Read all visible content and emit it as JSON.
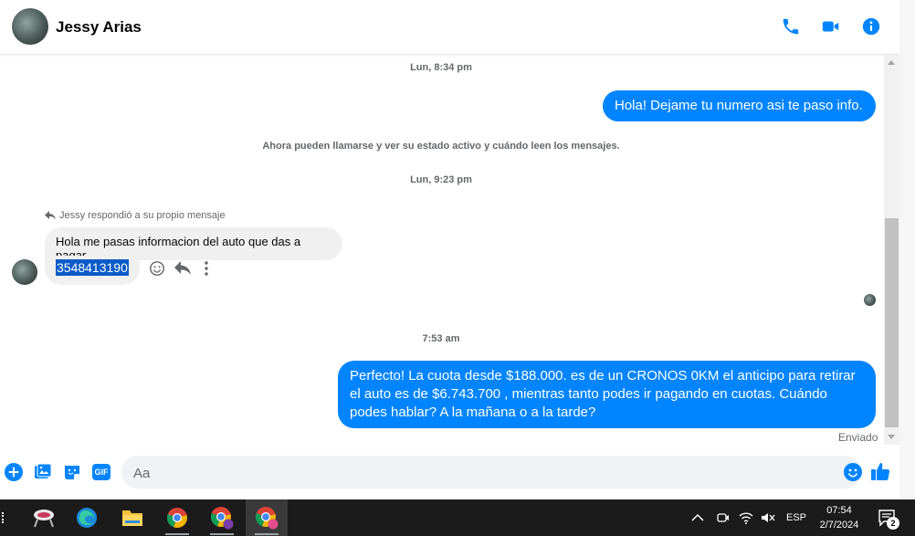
{
  "header": {
    "contact_name": "Jessy Arias",
    "icons": [
      "phone-icon",
      "video-icon",
      "info-icon"
    ],
    "accent": "#0084ff"
  },
  "conversation": {
    "timestamp_1": "Lun, 8:34 pm",
    "outgoing_1": "Hola! Dejame tu numero  asi te paso info.",
    "system_notice": "Ahora pueden llamarse y ver su estado activo y cuándo leen los mensajes.",
    "timestamp_2": "Lun, 9:23 pm",
    "reply_note": "Jessy respondió a su propio mensaje",
    "incoming_1": "Hola me pasas informacion del auto que das a pagar",
    "incoming_2_phone": "3548413190",
    "timestamp_3": "7:53 am",
    "outgoing_2": "Perfecto! La cuota desde $188.000. es de un CRONOS 0KM el anticipo para retirar el auto es de $6.743.700 , mientras tanto podes ir pagando en cuotas. Cuándo podes hablar? A la mañana o a la tarde?",
    "status": "Enviado"
  },
  "composer": {
    "placeholder": "Aa",
    "icons": [
      "plus-icon",
      "image-icon",
      "sticker-icon",
      "gif-icon",
      "emoji-icon",
      "like-icon"
    ],
    "gif_label": "GIF"
  },
  "taskbar": {
    "language": "ESP",
    "time": "07:54",
    "date": "2/7/2024",
    "notification_count": "2"
  }
}
